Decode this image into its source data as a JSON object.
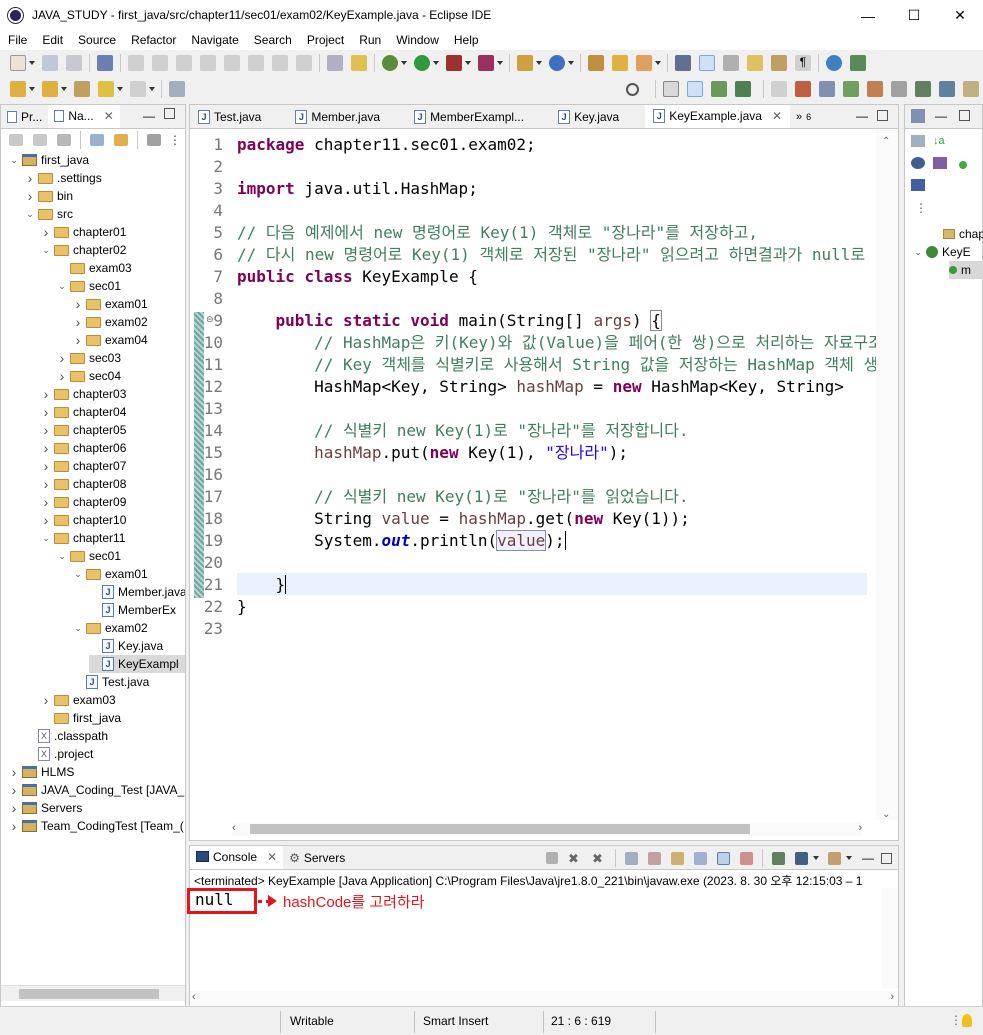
{
  "window": {
    "title": "JAVA_STUDY - first_java/src/chapter11/sec01/exam02/KeyExample.java - Eclipse IDE",
    "minimize": "—",
    "maximize": "☐",
    "close": "✕"
  },
  "menu": [
    "File",
    "Edit",
    "Source",
    "Refactor",
    "Navigate",
    "Search",
    "Project",
    "Run",
    "Window",
    "Help"
  ],
  "left_panel": {
    "tabs": [
      "Pr...",
      "Na..."
    ],
    "tree": [
      {
        "label": "first_java",
        "type": "project",
        "depth": 0,
        "expanded": true
      },
      {
        "label": ".settings",
        "type": "folder",
        "depth": 1,
        "expanded": false
      },
      {
        "label": "bin",
        "type": "folder",
        "depth": 1,
        "expanded": false
      },
      {
        "label": "src",
        "type": "folder",
        "depth": 1,
        "expanded": true
      },
      {
        "label": "chapter01",
        "type": "folder",
        "depth": 2,
        "expanded": false
      },
      {
        "label": "chapter02",
        "type": "folder",
        "depth": 2,
        "expanded": true
      },
      {
        "label": "exam03",
        "type": "folder",
        "depth": 3,
        "expanded": null
      },
      {
        "label": "sec01",
        "type": "folder",
        "depth": 3,
        "expanded": true
      },
      {
        "label": "exam01",
        "type": "folder",
        "depth": 4,
        "expanded": false
      },
      {
        "label": "exam02",
        "type": "folder",
        "depth": 4,
        "expanded": false
      },
      {
        "label": "exam04",
        "type": "folder",
        "depth": 4,
        "expanded": false
      },
      {
        "label": "sec03",
        "type": "folder",
        "depth": 3,
        "expanded": false
      },
      {
        "label": "sec04",
        "type": "folder",
        "depth": 3,
        "expanded": false
      },
      {
        "label": "chapter03",
        "type": "folder",
        "depth": 2,
        "expanded": false
      },
      {
        "label": "chapter04",
        "type": "folder",
        "depth": 2,
        "expanded": false
      },
      {
        "label": "chapter05",
        "type": "folder",
        "depth": 2,
        "expanded": false
      },
      {
        "label": "chapter06",
        "type": "folder",
        "depth": 2,
        "expanded": false
      },
      {
        "label": "chapter07",
        "type": "folder",
        "depth": 2,
        "expanded": false
      },
      {
        "label": "chapter08",
        "type": "folder",
        "depth": 2,
        "expanded": false
      },
      {
        "label": "chapter09",
        "type": "folder",
        "depth": 2,
        "expanded": false
      },
      {
        "label": "chapter10",
        "type": "folder",
        "depth": 2,
        "expanded": false
      },
      {
        "label": "chapter11",
        "type": "folder",
        "depth": 2,
        "expanded": true
      },
      {
        "label": "sec01",
        "type": "folder",
        "depth": 3,
        "expanded": true
      },
      {
        "label": "exam01",
        "type": "folder",
        "depth": 4,
        "expanded": true
      },
      {
        "label": "Member.java",
        "type": "java",
        "depth": 5,
        "expanded": null
      },
      {
        "label": "MemberEx",
        "type": "java",
        "depth": 5,
        "expanded": null
      },
      {
        "label": "exam02",
        "type": "folder",
        "depth": 4,
        "expanded": true
      },
      {
        "label": "Key.java",
        "type": "java",
        "depth": 5,
        "expanded": null
      },
      {
        "label": "KeyExampl",
        "type": "java",
        "depth": 5,
        "expanded": null,
        "selected": true
      },
      {
        "label": "Test.java",
        "type": "java",
        "depth": 4,
        "expanded": null
      },
      {
        "label": "exam03",
        "type": "folder",
        "depth": 2,
        "expanded": false
      },
      {
        "label": "first_java",
        "type": "folder",
        "depth": 2,
        "expanded": null
      },
      {
        "label": ".classpath",
        "type": "xfile",
        "depth": 1,
        "expanded": null
      },
      {
        "label": ".project",
        "type": "xfile",
        "depth": 1,
        "expanded": null
      },
      {
        "label": "HLMS",
        "type": "project",
        "depth": 0,
        "expanded": false
      },
      {
        "label": "JAVA_Coding_Test [JAVA_",
        "type": "project",
        "depth": 0,
        "expanded": false
      },
      {
        "label": "Servers",
        "type": "project",
        "depth": 0,
        "expanded": false
      },
      {
        "label": "Team_CodingTest [Team_(",
        "type": "project",
        "depth": 0,
        "expanded": false
      }
    ]
  },
  "editor": {
    "tabs": [
      {
        "label": "Test.java",
        "active": false
      },
      {
        "label": "Member.java",
        "active": false
      },
      {
        "label": "MemberExampl...",
        "active": false
      },
      {
        "label": "Key.java",
        "active": false
      },
      {
        "label": "KeyExample.java",
        "active": true
      }
    ],
    "overflow_count": "6",
    "lines": [
      {
        "n": "1",
        "html": "<span class='kw'>package</span> chapter11.sec01.exam02;"
      },
      {
        "n": "2",
        "html": ""
      },
      {
        "n": "3",
        "html": "<span class='kw'>import</span> java.util.HashMap;"
      },
      {
        "n": "4",
        "html": ""
      },
      {
        "n": "5",
        "html": "<span class='cm'>// 다음 예제에서 new 명령어로 Key(1) 객체로 \"장나라\"를 저장하고,</span>"
      },
      {
        "n": "6",
        "html": "<span class='cm'>// 다시 new 명령어로 Key(1) 객체로 저장된 \"장나라\" 읽으려고 하면결과가 null로 나</span>"
      },
      {
        "n": "7",
        "html": "<span class='kw'>public</span> <span class='kw'>class</span> KeyExample {"
      },
      {
        "n": "8",
        "html": ""
      },
      {
        "n": "9",
        "html": "    <span class='kw'>public</span> <span class='kw'>static</span> <span class='kw'>void</span> main(String[] <span class='var'>args</span>) <span style='outline:1px solid #888'>{</span>"
      },
      {
        "n": "10",
        "html": "        <span class='cm'>// HashMap은 키(Key)와 값(Value)을 페어(한 쌍)으로 처리하는 자료구조</span>"
      },
      {
        "n": "11",
        "html": "        <span class='cm'>// Key 객체를 식별키로 사용해서 String 값을 저장하는 HashMap 객체 생</span>"
      },
      {
        "n": "12",
        "html": "        HashMap&lt;Key, String&gt; <span class='var'>hashMap</span> = <span class='kw'>new</span> HashMap&lt;Key, String&gt;"
      },
      {
        "n": "13",
        "html": ""
      },
      {
        "n": "14",
        "html": "        <span class='cm'>// 식별키 new Key(1)로 \"장나라\"를 저장합니다.</span>"
      },
      {
        "n": "15",
        "html": "        <span class='var'>hashMap</span>.put(<span class='kw'>new</span> Key(1), <span class='str'>\"장나라\"</span>);"
      },
      {
        "n": "16",
        "html": ""
      },
      {
        "n": "17",
        "html": "        <span class='cm'>// 식별키 new Key(1)로 \"장나라\"를 읽었습니다.</span>"
      },
      {
        "n": "18",
        "html": "        String <span class='var'>value</span> = <span class='var'>hashMap</span>.get(<span class='kw'>new</span> Key(1));"
      },
      {
        "n": "19",
        "html": "        System.<span class='fld'>out</span>.println(<span class='var' style='outline:1px solid #8a8ac0;background:#f0f0ff'>value</span>);<span style='border-left:1px solid #000'></span>"
      },
      {
        "n": "20",
        "html": ""
      },
      {
        "n": "21",
        "html": "    }<span style='border-left:1px solid #000'></span>"
      },
      {
        "n": "22",
        "html": "}"
      },
      {
        "n": "23",
        "html": ""
      }
    ]
  },
  "console": {
    "tabs": [
      "Console",
      "Servers"
    ],
    "header": "<terminated> KeyExample [Java Application] C:\\Program Files\\Java\\jre1.8.0_221\\bin\\javaw.exe  (2023. 8. 30 오후 12:15:03 – 1",
    "output": "null",
    "annotation": "hashCode를 고려하라"
  },
  "outline": {
    "items": [
      "chap",
      "KeyE",
      "m"
    ]
  },
  "status": {
    "writable": "Writable",
    "insert_mode": "Smart Insert",
    "position": "21 : 6 : 619"
  },
  "colors": {
    "keyword": "#7f0055",
    "comment": "#3f7f5f",
    "string": "#2a00ff",
    "annotation_red": "#e8141c",
    "current_line": "#e8f2fe",
    "change_bar": "#6fa6a0"
  }
}
